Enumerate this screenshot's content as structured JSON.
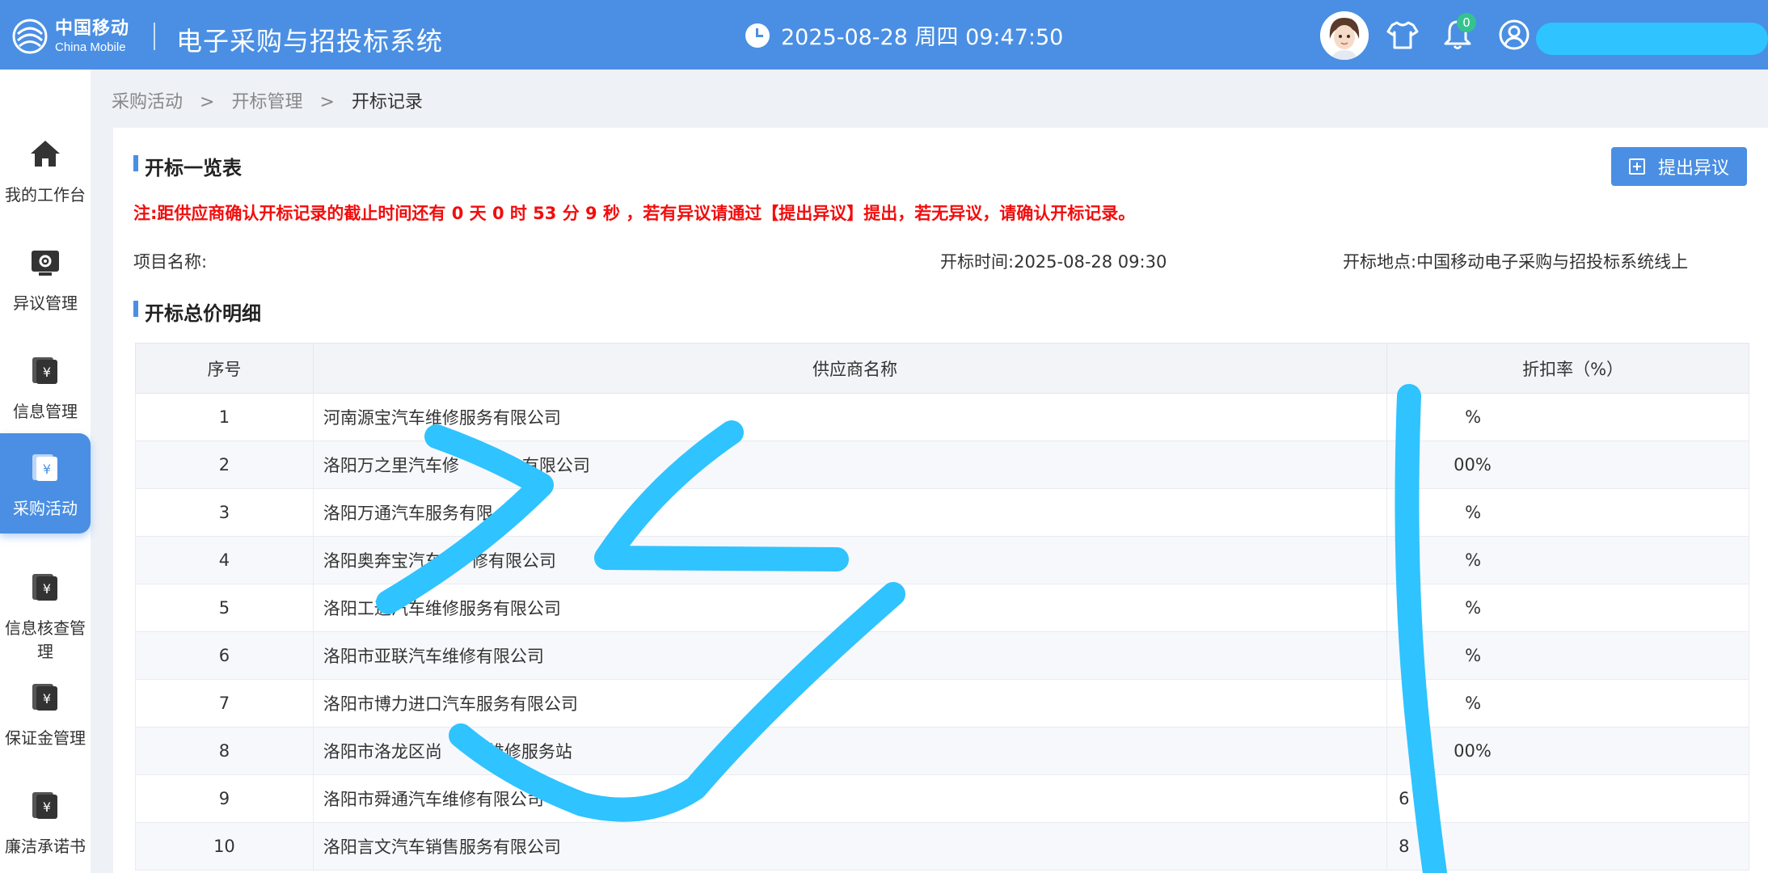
{
  "header": {
    "logo_cn": "中国移动",
    "logo_en": "China Mobile",
    "system_title": "电子采购与招投标系统",
    "datetime": "2025-08-28 周四 09:47:50",
    "notification_count": "0",
    "brand_color": "#4a8fe3"
  },
  "sidebar": {
    "items": [
      {
        "label": "我的工作台",
        "icon": "home-icon"
      },
      {
        "label": "异议管理",
        "icon": "gear-icon"
      },
      {
        "label": "信息管理",
        "icon": "yen-doc-icon"
      },
      {
        "label": "采购活动",
        "icon": "yen-doc-icon",
        "active": true
      },
      {
        "label": "信息核查管理",
        "icon": "yen-doc-icon"
      },
      {
        "label": "保证金管理",
        "icon": "yen-doc-icon"
      },
      {
        "label": "廉洁承诺书",
        "icon": "yen-doc-icon"
      }
    ]
  },
  "breadcrumb": {
    "level1": "采购活动",
    "level2": "开标管理",
    "current": "开标记录",
    "separator": ">"
  },
  "panel": {
    "title": "开标一览表",
    "objection_button": "提出异议",
    "notice": "注:距供应商确认开标记录的截止时间还有 0 天 0 时 53 分 9 秒 ，若有异议请通过【提出异议】提出，若无异议，请确认开标记录。",
    "project_label": "项目名称:",
    "open_time_label": "开标时间:",
    "open_time_value": "2025-08-28 09:30",
    "location_label": "开标地点:",
    "location_value": "中国移动电子采购与招投标系统线上",
    "detail_title": "开标总价明细"
  },
  "table": {
    "headers": [
      "序号",
      "供应商名称",
      "折扣率（%）"
    ],
    "rows": [
      {
        "no": "1",
        "name": "河南源宝汽车维修服务有限公司",
        "rate": "%"
      },
      {
        "no": "2",
        "name": "洛阳万之里汽车修",
        "name_tail": "有限公司",
        "rate": "00%"
      },
      {
        "no": "3",
        "name": "洛阳万通汽车服务有限",
        "rate": "%"
      },
      {
        "no": "4",
        "name": "洛阳奥奔宝汽车",
        "name_tail": "修有限公司",
        "rate": "%"
      },
      {
        "no": "5",
        "name": "洛阳工通汽车维修服务有限公司",
        "rate": "%"
      },
      {
        "no": "6",
        "name": "洛阳市亚联汽车维修有限公司",
        "rate": "%"
      },
      {
        "no": "7",
        "name": "洛阳市博力进口汽车服务有限公司",
        "rate": "%"
      },
      {
        "no": "8",
        "name": "洛阳市洛龙区尚",
        "name_tail": "维修服务站",
        "rate": "00%"
      },
      {
        "no": "9",
        "name": "洛阳市舜通汽车维修有限公司",
        "rate": "6"
      },
      {
        "no": "10",
        "name": "洛阳言文汽车销售服务有限公司",
        "rate": "8"
      }
    ]
  },
  "annotation_color": "#2fc3ff"
}
